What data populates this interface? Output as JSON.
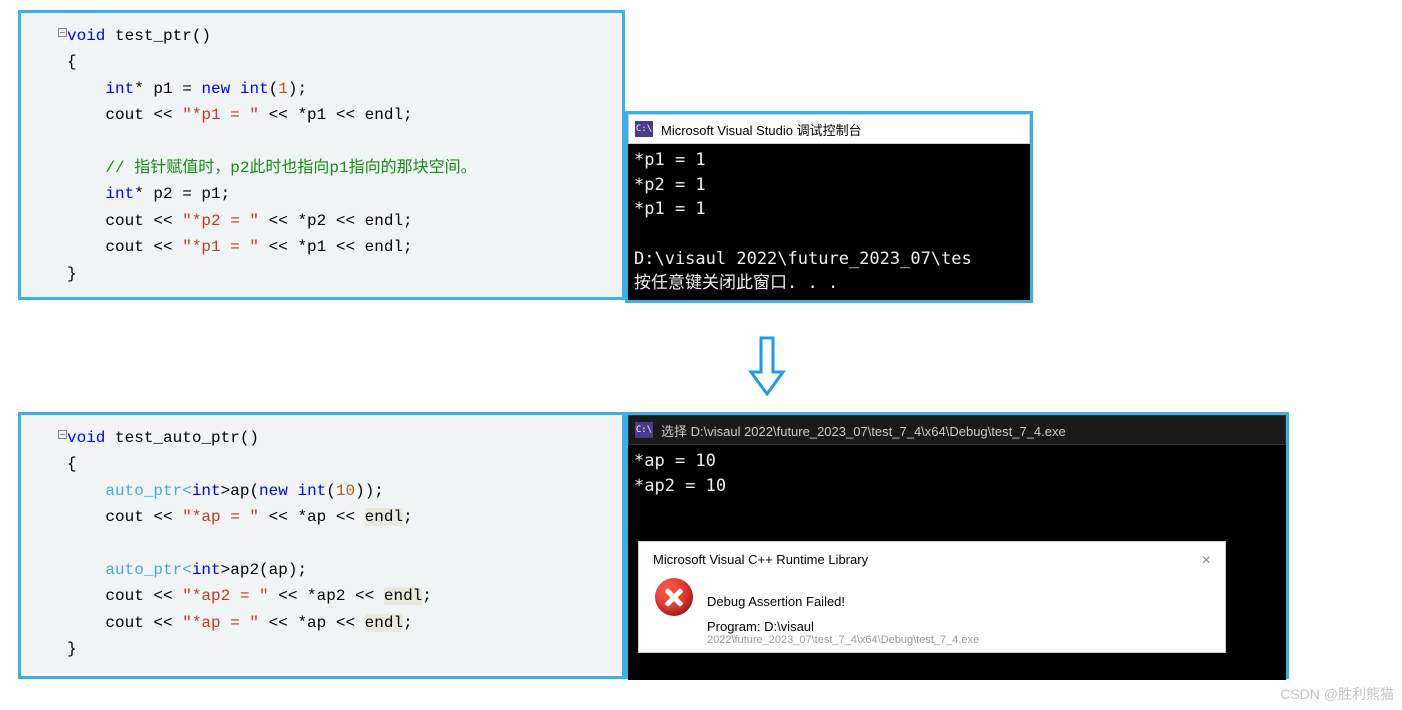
{
  "top": {
    "code": {
      "fn_kw": "void",
      "fn_name": " test_ptr()",
      "brace_open": "{",
      "l1_a": "int",
      "l1_b": "* p1 = ",
      "l1_c": "new",
      "l1_d": " ",
      "l1_e": "int",
      "l1_f": "(",
      "l1_g": "1",
      "l1_h": ");",
      "l2_a": "cout << ",
      "l2_b": "\"*p1 = \"",
      "l2_c": " << *p1 << endl;",
      "blank": "",
      "l3_cmt": "// 指针赋值时，p2此时也指向p1指向的那块空间。",
      "l4_a": "int",
      "l4_b": "* p2 = p1;",
      "l5_a": "cout << ",
      "l5_b": "\"*p2 = \"",
      "l5_c": " << *p2 << endl;",
      "l6_a": "cout << ",
      "l6_b": "\"*p1 = \"",
      "l6_c": " << *p1 << endl;",
      "brace_close": "}"
    },
    "console": {
      "title": "Microsoft Visual Studio 调试控制台",
      "line1": "*p1 = 1",
      "line2": "*p2 = 1",
      "line3": "*p1 = 1",
      "line4": "",
      "line5": "D:\\visaul 2022\\future_2023_07\\tes",
      "line6": "按任意键关闭此窗口. . ."
    }
  },
  "bottom": {
    "code": {
      "fn_kw": "void",
      "fn_name": " test_auto_ptr()",
      "brace_open": "{",
      "l1_a": "auto_ptr<",
      "l1_b": "int",
      "l1_c": ">ap(",
      "l1_d": "new",
      "l1_e": " ",
      "l1_f": "int",
      "l1_g": "(",
      "l1_h": "10",
      "l1_i": "));",
      "l2_a": "cout << ",
      "l2_b": "\"*ap = \"",
      "l2_c": " << *ap << ",
      "l2_d": "endl",
      "l2_e": ";",
      "blank": "",
      "l3_a": "auto_ptr<",
      "l3_b": "int",
      "l3_c": ">ap2(ap);",
      "l4_a": "cout << ",
      "l4_b": "\"*ap2 = \"",
      "l4_c": " << *ap2 << ",
      "l4_d": "endl",
      "l4_e": ";",
      "l5_a": "cout << ",
      "l5_b": "\"*ap = \"",
      "l5_c": " << *ap << ",
      "l5_d": "endl",
      "l5_e": ";",
      "brace_close": "}"
    },
    "console": {
      "title": "选择 D:\\visaul 2022\\future_2023_07\\test_7_4\\x64\\Debug\\test_7_4.exe",
      "line1": "*ap = 10",
      "line2": "*ap2 = 10",
      "line3": ""
    },
    "dialog": {
      "title": "Microsoft Visual C++ Runtime Library",
      "close": "×",
      "heading": "Debug Assertion Failed!",
      "line2": "Program: D:\\visaul",
      "line3": "2022\\future_2023_07\\test_7_4\\x64\\Debug\\test_7_4.exe"
    }
  },
  "watermark": "CSDN @胜利熊猫"
}
